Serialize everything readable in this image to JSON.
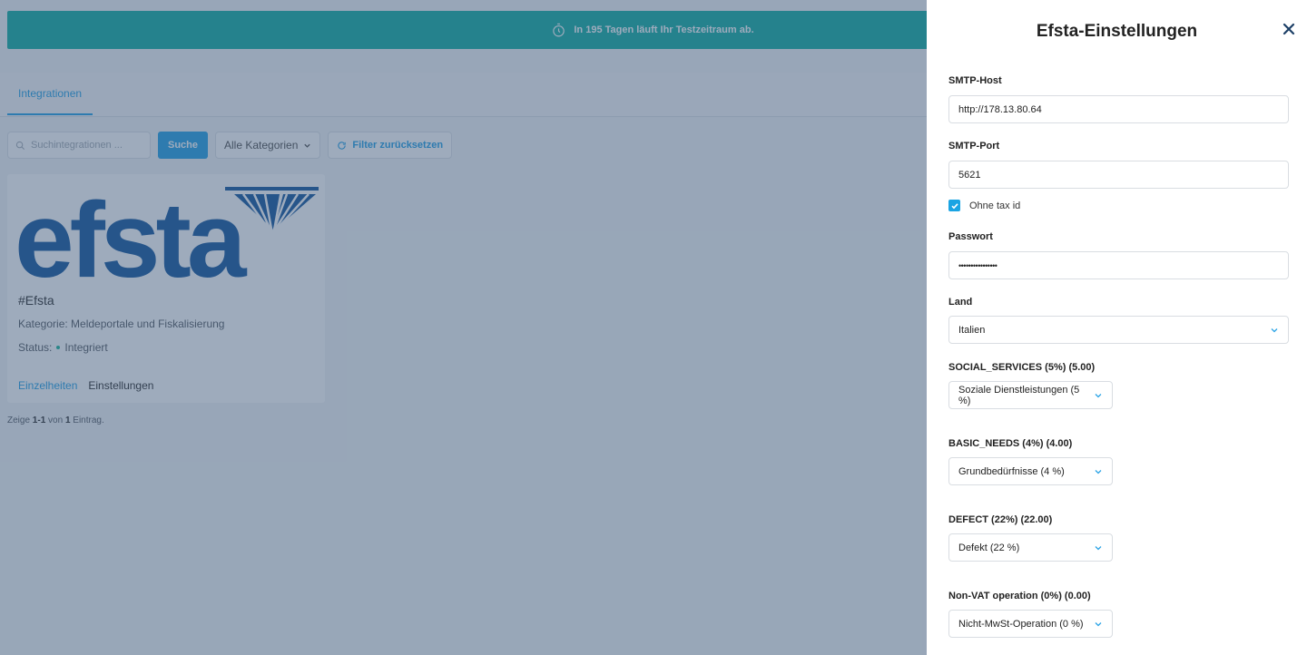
{
  "banner": {
    "text": "In 195 Tagen läuft Ihr Testzeitraum ab.",
    "icon": "stopwatch-icon"
  },
  "tabs": [
    {
      "label": "Integrationen",
      "active": true
    }
  ],
  "filters": {
    "search_placeholder": "Suchintegrationen ...",
    "search_button": "Suche",
    "category_select": "Alle Kategorien",
    "reset_button": "Filter zurücksetzen"
  },
  "integration_card": {
    "logo_text": "efsta",
    "title": "#Efsta",
    "category": "Kategorie: Meldeportale und Fiskalisierung",
    "status_label": "Status:",
    "status_value": "Integriert",
    "details_link": "Einzelheiten",
    "settings_link": "Einstellungen"
  },
  "pagination": {
    "prefix": "Zeige",
    "range": "1-1",
    "of": "von",
    "total": "1",
    "suffix": "Eintrag."
  },
  "drawer": {
    "title": "Efsta-Einstellungen",
    "smtp_host": {
      "label": "SMTP-Host",
      "value": "http://178.13.80.64"
    },
    "smtp_port": {
      "label": "SMTP-Port",
      "value": "5621"
    },
    "without_tax_id": {
      "label": "Ohne tax id",
      "checked": true
    },
    "password": {
      "label": "Passwort",
      "value": "••••••••••••••••"
    },
    "country": {
      "label": "Land",
      "value": "Italien"
    },
    "tax_mappings": [
      {
        "label": "SOCIAL_SERVICES (5%) (5.00)",
        "value": "Soziale Dienstleistungen (5 %)"
      },
      {
        "label": "BASIC_NEEDS (4%) (4.00)",
        "value": "Grundbedürfnisse (4 %)"
      },
      {
        "label": "DEFECT (22%) (22.00)",
        "value": "Defekt (22 %)"
      },
      {
        "label": "Non-VAT operation (0%) (0.00)",
        "value": "Nicht-MwSt-Operation (0 %)"
      }
    ]
  },
  "colors": {
    "accent": "#2aa3e6",
    "banner": "#17b0a6",
    "status_dot": "#1fb99c",
    "overlay": "#345072"
  }
}
